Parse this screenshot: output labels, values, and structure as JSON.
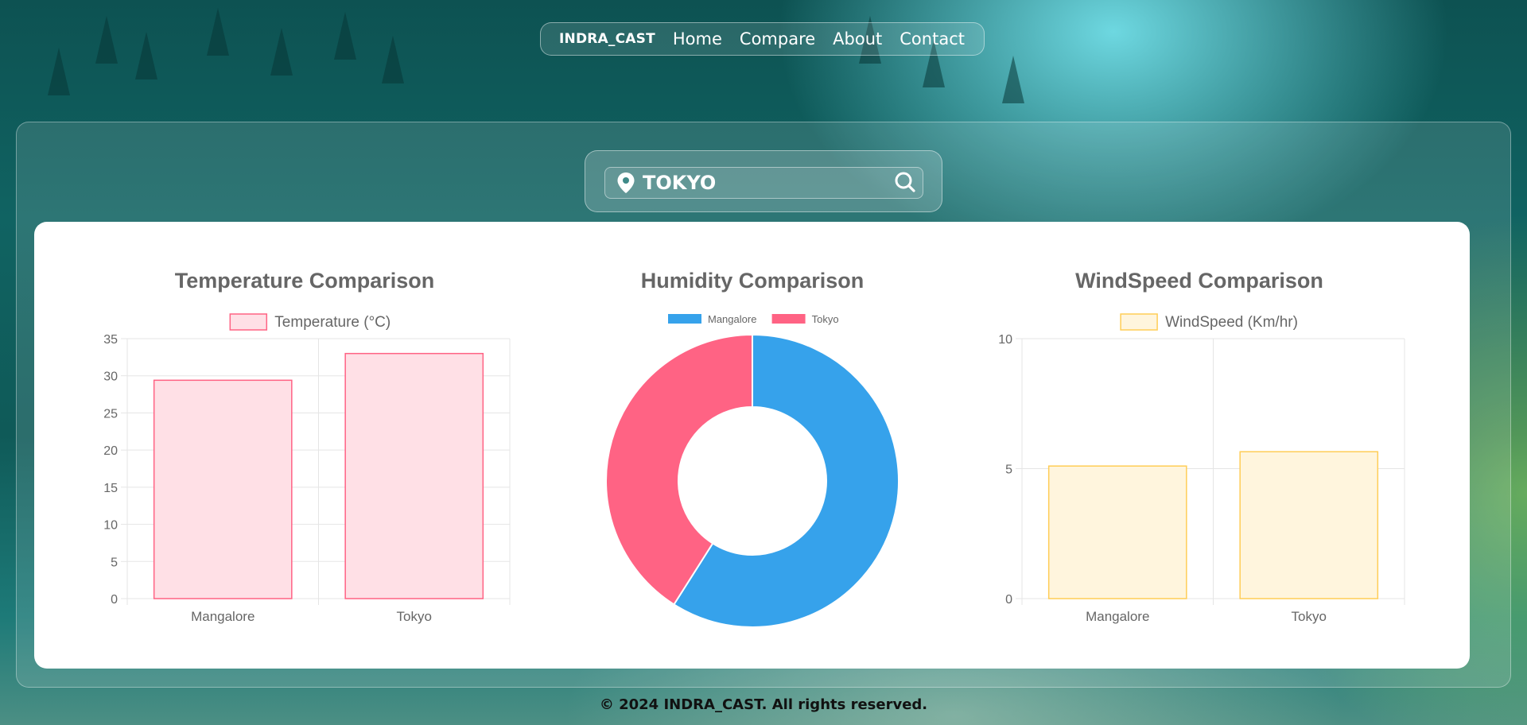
{
  "nav": {
    "brand": "INDRA_CAST",
    "links": [
      "Home",
      "Compare",
      "About",
      "Contact"
    ]
  },
  "search": {
    "value": "TOKYO",
    "icons": [
      "location-pin-icon",
      "search-icon"
    ]
  },
  "colors": {
    "temperature": "#ff6384",
    "temperature_fill": "#ffe0e6",
    "windspeed": "#ffcd56",
    "windspeed_fill": "#fff5dd",
    "mangalore": "#36a2eb",
    "tokyo": "#ff6384"
  },
  "chart_data": [
    {
      "type": "bar",
      "title": "Temperature Comparison",
      "legend": "Temperature (°C)",
      "categories": [
        "Mangalore",
        "Tokyo"
      ],
      "values": [
        29.4,
        33
      ],
      "ylim": [
        0,
        35
      ],
      "yticks": [
        0,
        5,
        10,
        15,
        20,
        25,
        30,
        35
      ],
      "grid": true,
      "legend_position": "top"
    },
    {
      "type": "pie",
      "title": "Humidity Comparison",
      "labels": [
        "Mangalore",
        "Tokyo"
      ],
      "values": [
        59,
        41
      ],
      "donut": true,
      "legend_position": "top"
    },
    {
      "type": "bar",
      "title": "WindSpeed Comparison",
      "legend": "WindSpeed (Km/hr)",
      "categories": [
        "Mangalore",
        "Tokyo"
      ],
      "values": [
        5.1,
        5.65
      ],
      "ylim": [
        0,
        10
      ],
      "yticks": [
        0,
        5,
        10
      ],
      "grid": true,
      "legend_position": "top"
    }
  ],
  "footer": "© 2024 INDRA_CAST. All rights reserved."
}
